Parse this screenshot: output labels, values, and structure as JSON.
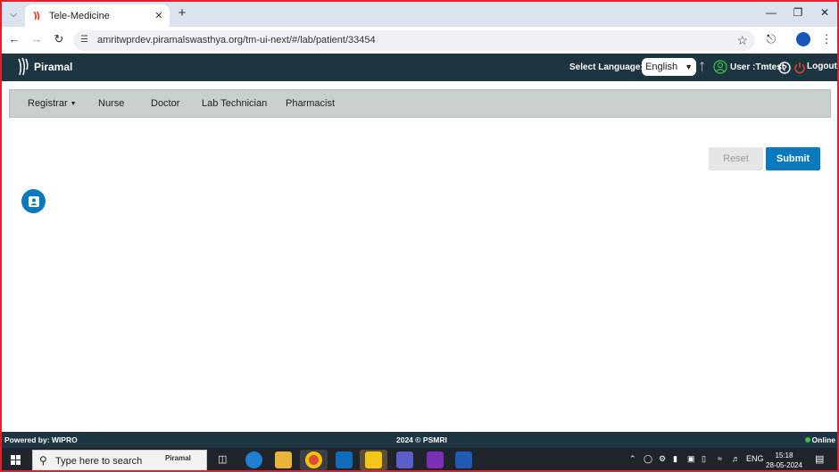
{
  "browser": {
    "tab_title": "Tele-Medicine",
    "url": "amritwprdev.piramalswasthya.org/tm-ui-next/#/lab/patient/33454"
  },
  "header": {
    "brand": "Piramal",
    "select_language_label": "Select Language:",
    "language_value": "English",
    "user_text": "User :Tmtest",
    "logout_label": "Logout"
  },
  "roles": {
    "registrar": "Registrar",
    "nurse": "Nurse",
    "doctor": "Doctor",
    "lab_technician": "Lab Technician",
    "pharmacist": "Pharmacist"
  },
  "actions": {
    "reset": "Reset",
    "submit": "Submit"
  },
  "footer": {
    "powered_by": "Powered by: WIPRO",
    "copyright": "2024 © PSMRI",
    "status": "Online"
  },
  "taskbar": {
    "search_placeholder": "Type here to search",
    "search_brand": "Piramal",
    "lang": "ENG",
    "time": "15:18",
    "date": "28-05-2024"
  },
  "colors": {
    "header_bg": "#1d3441",
    "primary": "#0a79be",
    "frame_border": "#e0202a"
  }
}
